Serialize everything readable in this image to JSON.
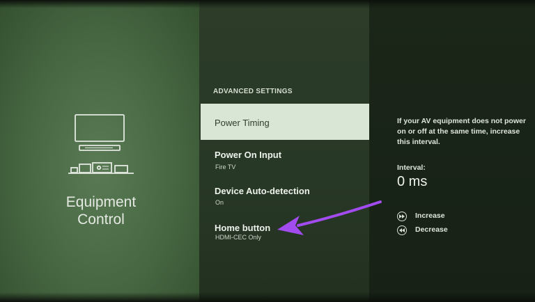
{
  "left": {
    "title_line1": "Equipment",
    "title_line2": "Control",
    "icon": "tv-and-equipment-icon"
  },
  "menu": {
    "heading": "ADVANCED SETTINGS",
    "items": [
      {
        "label": "Power Timing",
        "sub": "",
        "selected": true
      },
      {
        "label": "Power On Input",
        "sub": "Fire TV",
        "selected": false
      },
      {
        "label": "Device Auto-detection",
        "sub": "On",
        "selected": false
      },
      {
        "label": "Home button",
        "sub": "HDMI-CEC Only",
        "selected": false
      }
    ]
  },
  "detail": {
    "help": "If your AV equipment does not power on or off at the same time, increase this interval.",
    "interval_label": "Interval:",
    "interval_value": "0 ms",
    "controls": [
      {
        "label": "Increase",
        "icon": "fast-forward-icon"
      },
      {
        "label": "Decrease",
        "icon": "rewind-icon"
      }
    ]
  },
  "annotation": {
    "icon": "arrow-pointer-icon",
    "color": "#a24cf0"
  },
  "colors": {
    "selected_bg": "#d9e5d5",
    "selected_text": "#2f3e2c",
    "left_bg": "#4a6a45",
    "mid_bg": "#2c3c29",
    "right_bg": "#1b2619"
  }
}
